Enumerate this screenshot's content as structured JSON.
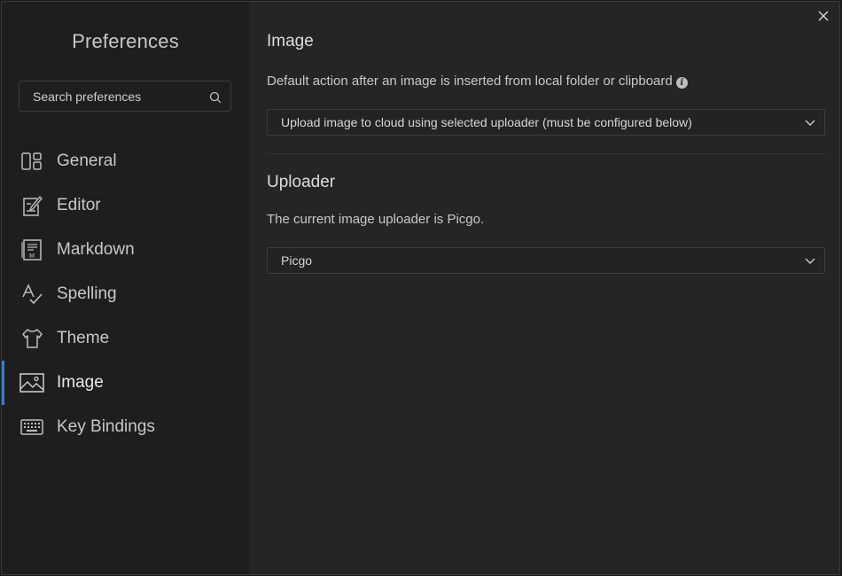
{
  "sidebar": {
    "title": "Preferences",
    "search_placeholder": "Search preferences",
    "items": [
      {
        "label": "General",
        "icon": "general-icon"
      },
      {
        "label": "Editor",
        "icon": "editor-icon"
      },
      {
        "label": "Markdown",
        "icon": "markdown-icon"
      },
      {
        "label": "Spelling",
        "icon": "spelling-icon"
      },
      {
        "label": "Theme",
        "icon": "theme-icon"
      },
      {
        "label": "Image",
        "icon": "image-icon",
        "active": true
      },
      {
        "label": "Key Bindings",
        "icon": "keyboard-icon"
      }
    ]
  },
  "main": {
    "image_section": {
      "title": "Image",
      "description": "Default action after an image is inserted from local folder or clipboard",
      "action_select_value": "Upload image to cloud using selected uploader (must be configured below)"
    },
    "uploader_section": {
      "title": "Uploader",
      "description": "The current image uploader is Picgo.",
      "uploader_select_value": "Picgo"
    }
  },
  "colors": {
    "accent": "#2f7fd1",
    "sidebar_bg": "#1e1e1e",
    "content_bg": "#252525"
  }
}
